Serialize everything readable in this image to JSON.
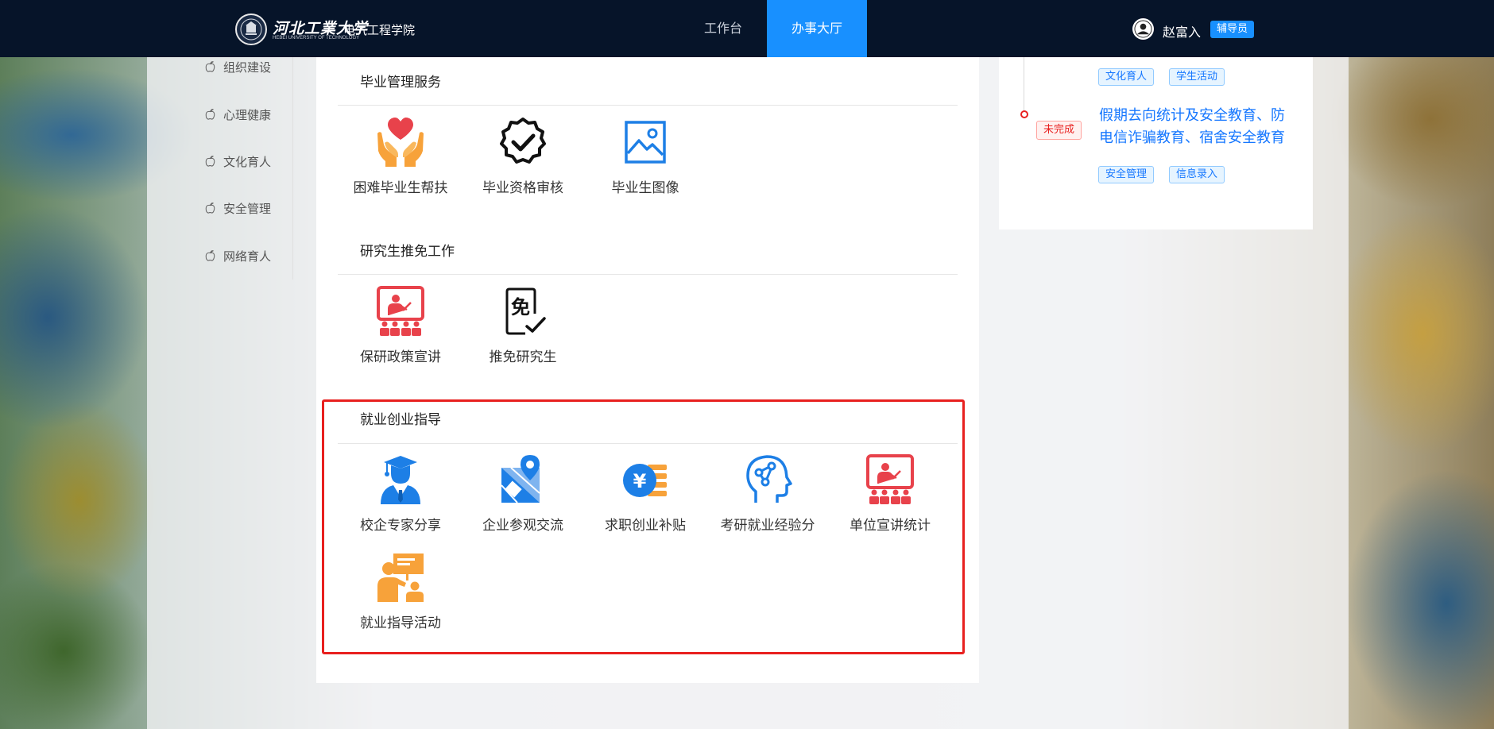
{
  "header": {
    "university_name": "河北工業大学",
    "university_subname": "HEBEI UNIVERSITY OF TECHNOLOGY",
    "college_name": "电气工程学院",
    "nav": {
      "workbench": "工作台",
      "service_hall": "办事大厅"
    },
    "user": {
      "name": "赵富入",
      "role": "辅导员"
    }
  },
  "sidebar": {
    "items": [
      {
        "label": "组织建设"
      },
      {
        "label": "心理健康"
      },
      {
        "label": "文化育人"
      },
      {
        "label": "安全管理"
      },
      {
        "label": "网络育人"
      }
    ]
  },
  "sections": [
    {
      "title": "毕业管理服务",
      "items": [
        {
          "label": "困难毕业生帮扶",
          "icon": "hands-heart-icon"
        },
        {
          "label": "毕业资格审核",
          "icon": "verified-badge-icon"
        },
        {
          "label": "毕业生图像",
          "icon": "image-icon"
        }
      ]
    },
    {
      "title": "研究生推免工作",
      "items": [
        {
          "label": "保研政策宣讲",
          "icon": "presentation-icon"
        },
        {
          "label": "推免研究生",
          "icon": "exempt-check-icon",
          "glyph": "免"
        }
      ]
    },
    {
      "title": "就业创业指导",
      "items": [
        {
          "label": "校企专家分享",
          "icon": "graduate-icon"
        },
        {
          "label": "企业参观交流",
          "icon": "map-pin-icon"
        },
        {
          "label": "求职创业补贴",
          "icon": "yuan-coin-icon",
          "glyph": "¥"
        },
        {
          "label": "考研就业经验分",
          "icon": "brain-head-icon"
        },
        {
          "label": "单位宣讲统计",
          "icon": "presentation-icon"
        },
        {
          "label": "就业指导活动",
          "icon": "teaching-board-icon"
        }
      ]
    }
  ],
  "right_panel": {
    "prev_tags": [
      "文化育人",
      "学生活动"
    ],
    "task": {
      "status": "未完成",
      "title": "假期去向统计及安全教育、防电信诈骗教育、宿舍安全教育",
      "tags": [
        "安全管理",
        "信息录入"
      ]
    }
  },
  "colors": {
    "topbar": "#061429",
    "accent": "#1890ff",
    "highlight": "#e8201f",
    "icon_red": "#e8424b",
    "icon_orange": "#f7a23a",
    "icon_blue": "#1d7fe6"
  }
}
